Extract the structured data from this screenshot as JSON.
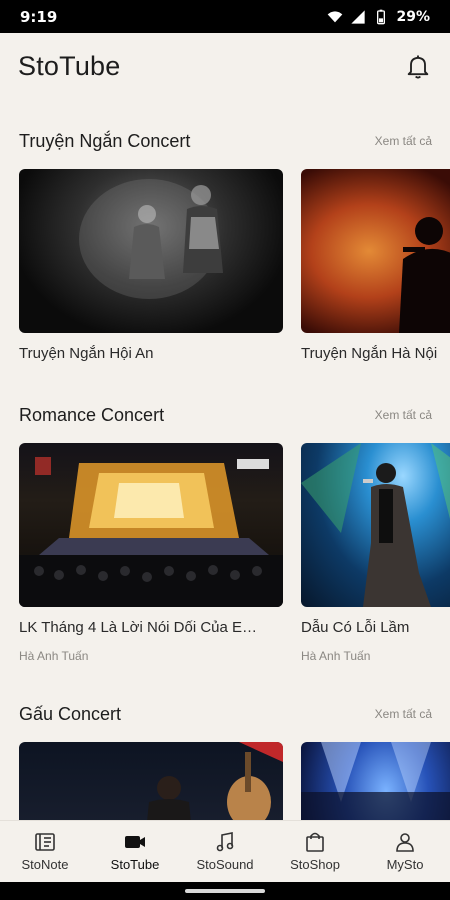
{
  "status": {
    "time": "9:19",
    "battery": "29%"
  },
  "header": {
    "title": "StoTube"
  },
  "sections": [
    {
      "title": "Truyện Ngắn Concert",
      "see_all": "Xem tất cả",
      "cards": [
        {
          "title": "Truyện Ngắn Hội An",
          "subtitle": ""
        },
        {
          "title": "Truyện Ngắn Hà Nội",
          "subtitle": ""
        }
      ]
    },
    {
      "title": "Romance Concert",
      "see_all": "Xem tất cả",
      "cards": [
        {
          "title": "LK Tháng 4 Là Lời Nói Dối Của E…",
          "subtitle": "Hà Anh Tuấn"
        },
        {
          "title": "Dẫu Có Lỗi Lầm",
          "subtitle": "Hà Anh Tuấn"
        }
      ]
    },
    {
      "title": "Gấu Concert",
      "see_all": "Xem tất cả",
      "cards": [
        {
          "title": "",
          "subtitle": ""
        },
        {
          "title": "",
          "subtitle": ""
        }
      ]
    }
  ],
  "nav": [
    {
      "label": "StoNote",
      "icon": "note-icon"
    },
    {
      "label": "StoTube",
      "icon": "video-icon",
      "active": true
    },
    {
      "label": "StoSound",
      "icon": "music-icon"
    },
    {
      "label": "StoShop",
      "icon": "shopping-bag-icon"
    },
    {
      "label": "MySto",
      "icon": "person-icon"
    }
  ]
}
